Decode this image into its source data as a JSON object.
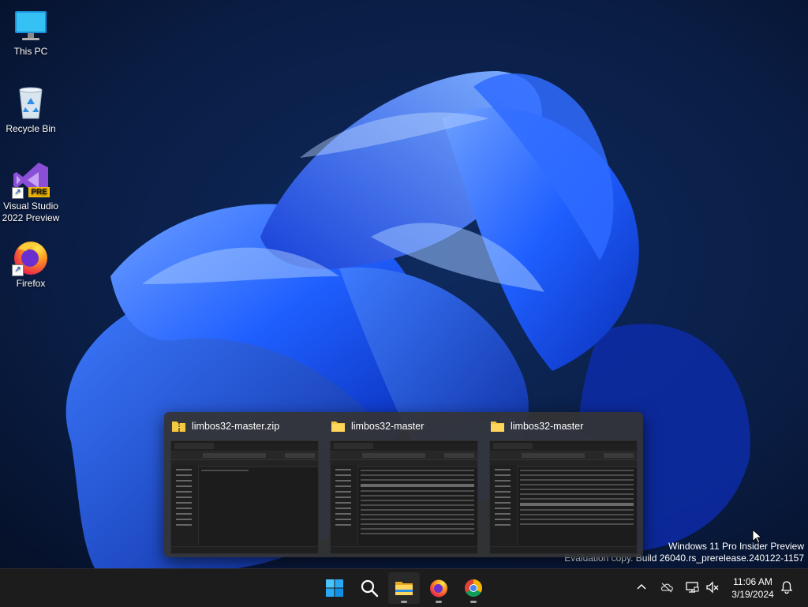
{
  "desktop": {
    "icons": [
      {
        "label": "This PC",
        "icon": "monitor-icon"
      },
      {
        "label": "Recycle Bin",
        "icon": "recycle-bin-icon"
      },
      {
        "label": "Visual Studio 2022 Preview",
        "icon": "visual-studio-icon",
        "badge": "PRE"
      },
      {
        "label": "Firefox",
        "icon": "firefox-icon"
      }
    ],
    "shortcut_arrow": "↗"
  },
  "preview": {
    "thumbnails": [
      {
        "title": "limbos32-master.zip",
        "icon": "zip-folder-icon"
      },
      {
        "title": "limbos32-master",
        "icon": "folder-icon"
      },
      {
        "title": "limbos32-master",
        "icon": "folder-icon"
      }
    ]
  },
  "watermark": {
    "line1": "Windows 11 Pro Insider Preview",
    "line2": "Evaluation copy. Build 26040.rs_prerelease.240122-1157"
  },
  "taskbar": {
    "pinned": [
      {
        "name": "start",
        "icon": "windows-logo-icon",
        "running": false
      },
      {
        "name": "search",
        "icon": "search-icon",
        "running": false
      },
      {
        "name": "file-explorer",
        "icon": "folder-icon",
        "running": true
      },
      {
        "name": "firefox",
        "icon": "firefox-icon",
        "running": true
      },
      {
        "name": "chrome",
        "icon": "chrome-icon",
        "running": true
      }
    ],
    "tray": {
      "icons": [
        "chevron-up-icon",
        "onedrive-offline-icon",
        "network-icon",
        "speaker-muted-icon",
        "notification-bell-icon"
      ],
      "time": "11:06 AM",
      "date": "3/19/2024"
    }
  },
  "colors": {
    "accent_blue": "#1f5fff",
    "taskbar_bg": "#1c1c1c",
    "desktop_bg": "#07142e"
  }
}
